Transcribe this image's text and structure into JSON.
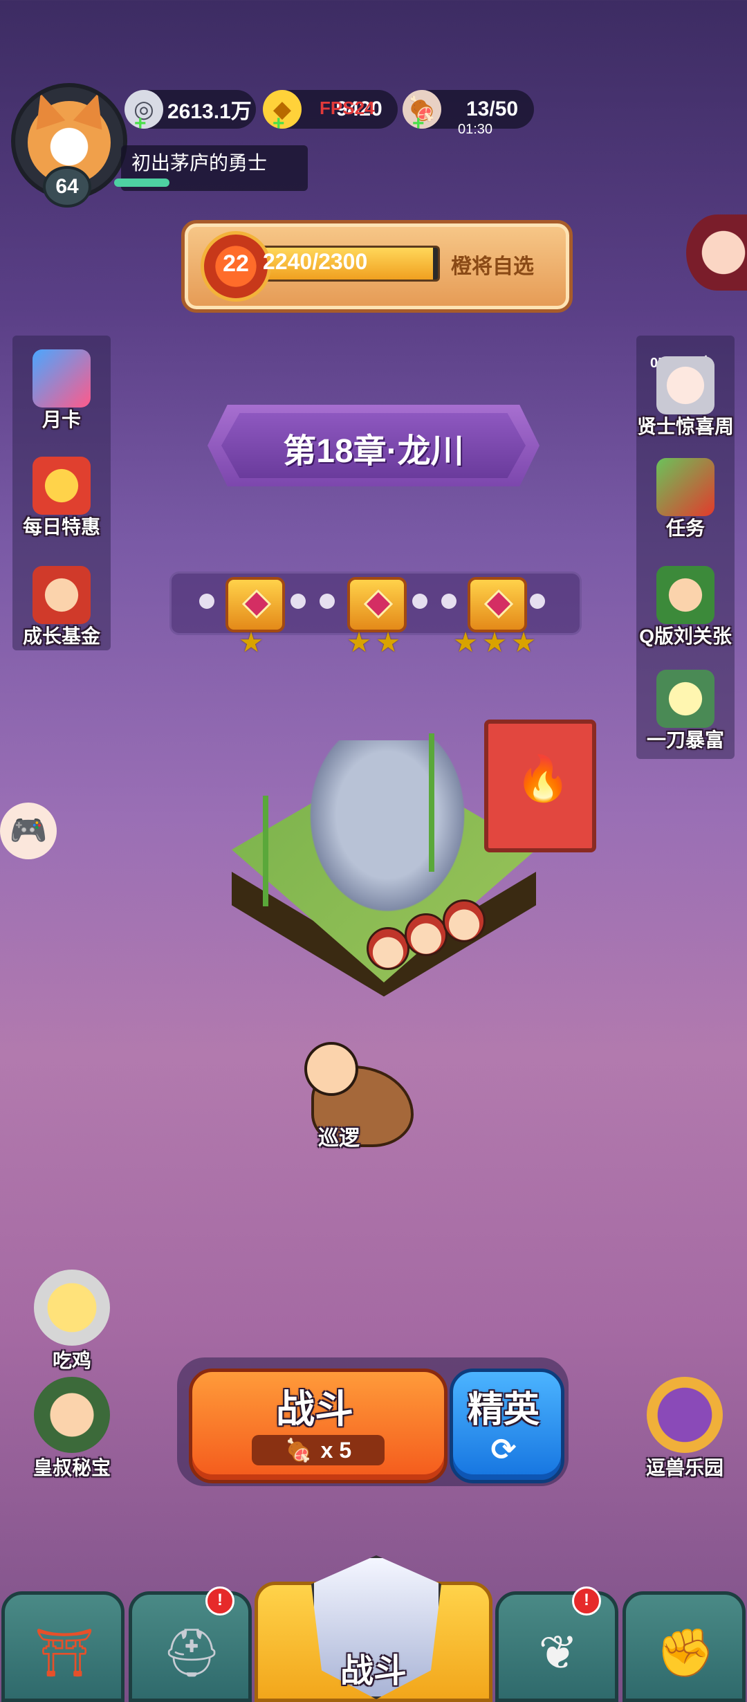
{
  "player": {
    "level": "64",
    "title": "初出茅庐的勇士"
  },
  "resources": {
    "silver": "2613.1万",
    "gold": "9420",
    "fps_overlay": "FPS24",
    "stamina": "13/50",
    "stamina_timer": "01:30"
  },
  "banner": {
    "level": "22",
    "progress_text": "2240/2300",
    "progress_fraction": 0.974,
    "select_label": "橙将自选"
  },
  "left_panel": {
    "items": [
      {
        "label": "月卡"
      },
      {
        "label": "每日特惠"
      },
      {
        "label": "成长基金"
      }
    ]
  },
  "right_panel": {
    "timer": "05天13时",
    "items": [
      {
        "label": "贤士惊喜周"
      },
      {
        "label": "任务"
      },
      {
        "label": "Q版刘关张"
      },
      {
        "label": "一刀暴富"
      }
    ]
  },
  "chapter": {
    "title": "第18章·龙川"
  },
  "star_rewards": [
    {
      "stars": 1
    },
    {
      "stars": 2
    },
    {
      "stars": 3
    }
  ],
  "hero": {
    "label": "巡逻"
  },
  "bottom_left": {
    "items": [
      {
        "label": "吃鸡"
      },
      {
        "label": "皇叔秘宝"
      }
    ]
  },
  "bottom_right": {
    "label": "逗兽乐园"
  },
  "battle": {
    "fight_label": "战斗",
    "cost_multiplier": "x 5",
    "elite_label": "精英"
  },
  "nav": {
    "center_label": "战斗",
    "badges": [
      "!",
      "!"
    ]
  },
  "colors": {
    "accent_orange": "#f45a1c",
    "elite_blue": "#1574e0",
    "nav_gold": "#f2a61b"
  }
}
